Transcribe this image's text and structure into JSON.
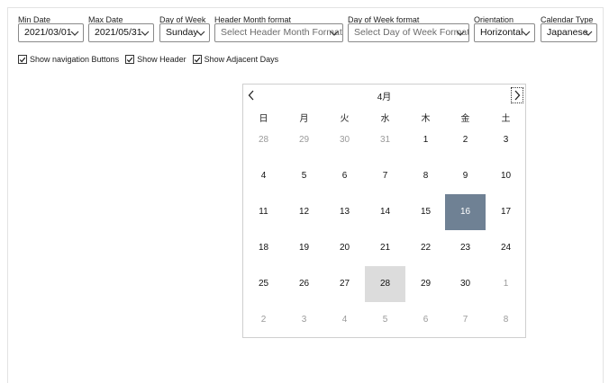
{
  "filters": [
    {
      "id": "min-date",
      "label": "Min Date",
      "value": "2021/03/01",
      "placeholder": false
    },
    {
      "id": "max-date",
      "label": "Max Date",
      "value": "2021/05/31",
      "placeholder": false
    },
    {
      "id": "day-of-week",
      "label": "Day of Week",
      "value": "Sunday",
      "placeholder": false
    },
    {
      "id": "header-month-format",
      "label": "Header Month format",
      "value": "Select Header Month Format",
      "placeholder": true
    },
    {
      "id": "day-of-week-format",
      "label": "Day of Week format",
      "value": "Select Day of Week Format",
      "placeholder": true
    },
    {
      "id": "orientation",
      "label": "Orientation",
      "value": "Horizontal",
      "placeholder": false
    },
    {
      "id": "calendar-type",
      "label": "Calendar Type",
      "value": "Japanese",
      "placeholder": false
    }
  ],
  "options": [
    {
      "id": "show-navigation-buttons",
      "label": "Show navigation Buttons",
      "checked": true
    },
    {
      "id": "show-header",
      "label": "Show Header",
      "checked": true
    },
    {
      "id": "show-adjacent-days",
      "label": "Show Adjacent Days",
      "checked": true
    }
  ],
  "calendar": {
    "month_label": "4月",
    "weekdays": [
      "日",
      "月",
      "火",
      "水",
      "木",
      "金",
      "土"
    ],
    "weeks": [
      [
        {
          "d": "28",
          "adj": true
        },
        {
          "d": "29",
          "adj": true
        },
        {
          "d": "30",
          "adj": true
        },
        {
          "d": "31",
          "adj": true
        },
        {
          "d": "1"
        },
        {
          "d": "2"
        },
        {
          "d": "3"
        }
      ],
      [
        {
          "d": "4"
        },
        {
          "d": "5"
        },
        {
          "d": "6"
        },
        {
          "d": "7"
        },
        {
          "d": "8"
        },
        {
          "d": "9"
        },
        {
          "d": "10"
        }
      ],
      [
        {
          "d": "11"
        },
        {
          "d": "12"
        },
        {
          "d": "13"
        },
        {
          "d": "14"
        },
        {
          "d": "15"
        },
        {
          "d": "16",
          "selected": true
        },
        {
          "d": "17"
        }
      ],
      [
        {
          "d": "18"
        },
        {
          "d": "19"
        },
        {
          "d": "20"
        },
        {
          "d": "21"
        },
        {
          "d": "22"
        },
        {
          "d": "23"
        },
        {
          "d": "24"
        }
      ],
      [
        {
          "d": "25"
        },
        {
          "d": "26"
        },
        {
          "d": "27"
        },
        {
          "d": "28",
          "today": true
        },
        {
          "d": "29"
        },
        {
          "d": "30"
        },
        {
          "d": "1",
          "adj": true
        }
      ],
      [
        {
          "d": "2",
          "adj": true
        },
        {
          "d": "3",
          "adj": true
        },
        {
          "d": "4",
          "adj": true
        },
        {
          "d": "5",
          "adj": true
        },
        {
          "d": "6",
          "adj": true
        },
        {
          "d": "7",
          "adj": true
        },
        {
          "d": "8",
          "adj": true
        }
      ]
    ]
  },
  "colors": {
    "selected": "#6f8194",
    "today": "#dcdcdc",
    "adjacent_text": "#9a9a9a"
  },
  "icons": {
    "dropdown": "chevron-down-icon",
    "prev": "chevron-left-icon",
    "next": "chevron-right-icon",
    "check": "check-icon"
  }
}
